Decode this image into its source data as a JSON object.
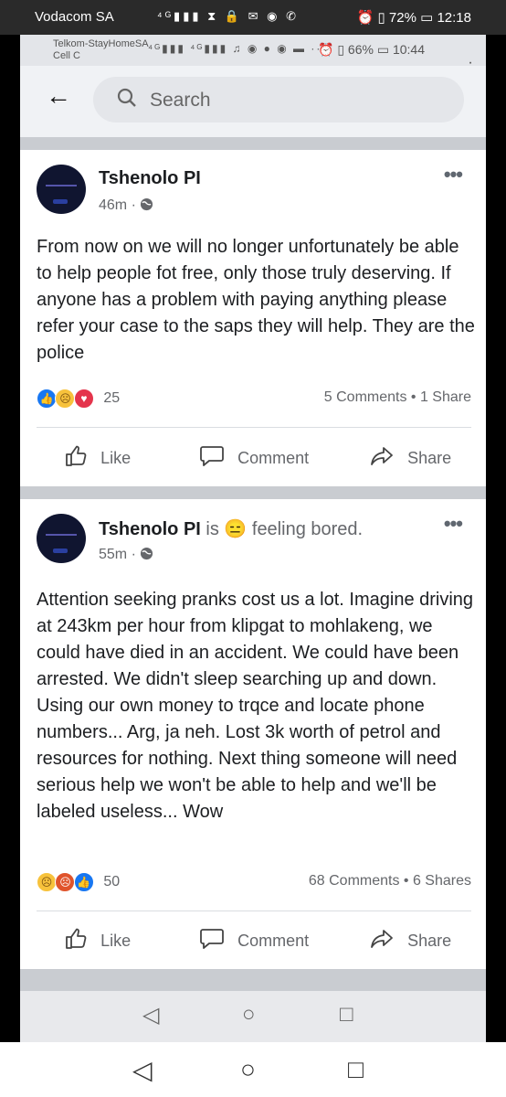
{
  "outer_status": {
    "carrier": "Vodacom SA",
    "icons": "⁴ᴳ▮▮▮ ⧗ 🔒 ✉ ◉ ✆",
    "right": "⏰ ▯ 72% ▭ 12:18"
  },
  "inner_status": {
    "carrier_line1": "Telkom-StayHomeSA",
    "carrier_line2": "Cell C",
    "icons": "⁴ᴳ▮▮▮ ⁴ᴳ▮▮▮ ♫ ◉ ● ◉ ▬ ···",
    "right": "⏰ ▯ 66% ▭ 10:44"
  },
  "search": {
    "placeholder": "Search",
    "back_icon": "←",
    "search_icon": "⚲"
  },
  "posts": [
    {
      "author": "Tshenolo PI",
      "feeling": "",
      "time": "46m",
      "audience_icon": "🌐",
      "text": "From now on we will no longer unfortunately be able to help people fot free, only those truly deserving. If anyone has a problem with paying anything please refer your case to the saps they will help. They are the police",
      "reactions": [
        "like",
        "sad",
        "love"
      ],
      "reaction_count": "25",
      "comments_shares": "5 Comments • 1 Share"
    },
    {
      "author": "Tshenolo PI",
      "feeling": "is 😑 feeling bored.",
      "time": "55m",
      "audience_icon": "🌐",
      "text": "Attention seeking pranks cost us a lot. Imagine driving at 243km per hour from klipgat to mohlakeng, we could have died in an accident. We could have been arrested. We didn't sleep searching up and down. Using our own money to trqce and locate phone numbers... Arg, ja neh. Lost 3k worth of petrol and resources for nothing. Next thing someone will need serious help we won't be able to help and we'll be labeled useless... Wow",
      "reactions": [
        "sad",
        "angry",
        "like"
      ],
      "reaction_count": "50",
      "comments_shares": "68 Comments • 6 Shares"
    }
  ],
  "actions": {
    "like": "Like",
    "comment": "Comment",
    "share": "Share"
  },
  "nav": {
    "back": "◁",
    "home": "○",
    "recents": "□"
  },
  "colors": {
    "facebook_blue": "#1877f2",
    "love_red": "#e4344c",
    "text": "#1c1e21",
    "secondary": "#65676b"
  }
}
